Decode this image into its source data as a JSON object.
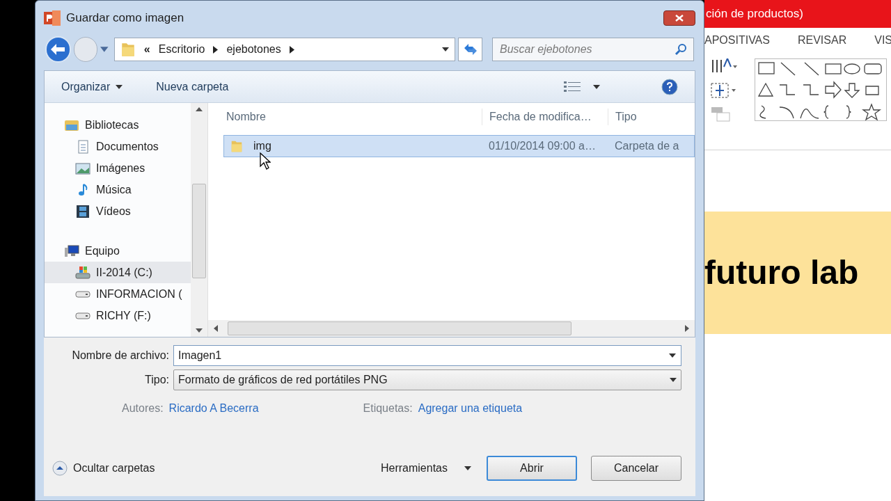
{
  "dialog": {
    "title": "Guardar como imagen",
    "address": {
      "overflow": "«",
      "crumbs": [
        "Escritorio",
        "ejebotones"
      ]
    },
    "search": {
      "placeholder": "Buscar ejebotones"
    },
    "toolbar": [
      {
        "label": "Organizar",
        "kind": "menu"
      },
      {
        "label": "Nueva carpeta",
        "kind": "button"
      }
    ],
    "nav": [
      {
        "label": "Bibliotecas",
        "kind": "library",
        "selected": false,
        "children": [
          {
            "label": "Documentos",
            "kind": "document",
            "selected": false
          },
          {
            "label": "Imágenes",
            "kind": "image",
            "selected": false
          },
          {
            "label": "Música",
            "kind": "music",
            "selected": false
          },
          {
            "label": "Vídeos",
            "kind": "video",
            "selected": false
          }
        ]
      },
      {
        "label": "Equipo",
        "kind": "computer",
        "selected": false,
        "children": [
          {
            "label": "II-2014 (C:)",
            "kind": "system-drive",
            "selected": true
          },
          {
            "label": "INFORMACION (",
            "kind": "drive",
            "selected": false
          },
          {
            "label": "RICHY (F:)",
            "kind": "drive",
            "selected": false
          }
        ]
      }
    ],
    "columns": [
      "Nombre",
      "Fecha de modifica…",
      "Tipo"
    ],
    "rows": [
      {
        "name": "img",
        "date": "01/10/2014 09:00 a…",
        "type": "Carpeta de a",
        "selected": true
      }
    ],
    "filename": {
      "label": "Nombre de archivo:",
      "value": "Imagen1"
    },
    "filetype": {
      "label": "Tipo:",
      "value": "Formato de gráficos de red portátiles PNG"
    },
    "meta": [
      {
        "label": "Autores:",
        "value": "Ricardo A Becerra"
      },
      {
        "label": "Etiquetas:",
        "value": "Agregar una etiqueta"
      }
    ],
    "hide_folders": "Ocultar carpetas",
    "tools": "Herramientas",
    "buttons": [
      {
        "label": "Abrir",
        "kind": "default"
      },
      {
        "label": "Cancelar",
        "kind": "normal"
      }
    ]
  },
  "background_app": {
    "title": "ción de productos)",
    "tabs": [
      "APOSITIVAS",
      "REVISAR",
      "VIS"
    ],
    "slide_text": "futuro lab"
  }
}
